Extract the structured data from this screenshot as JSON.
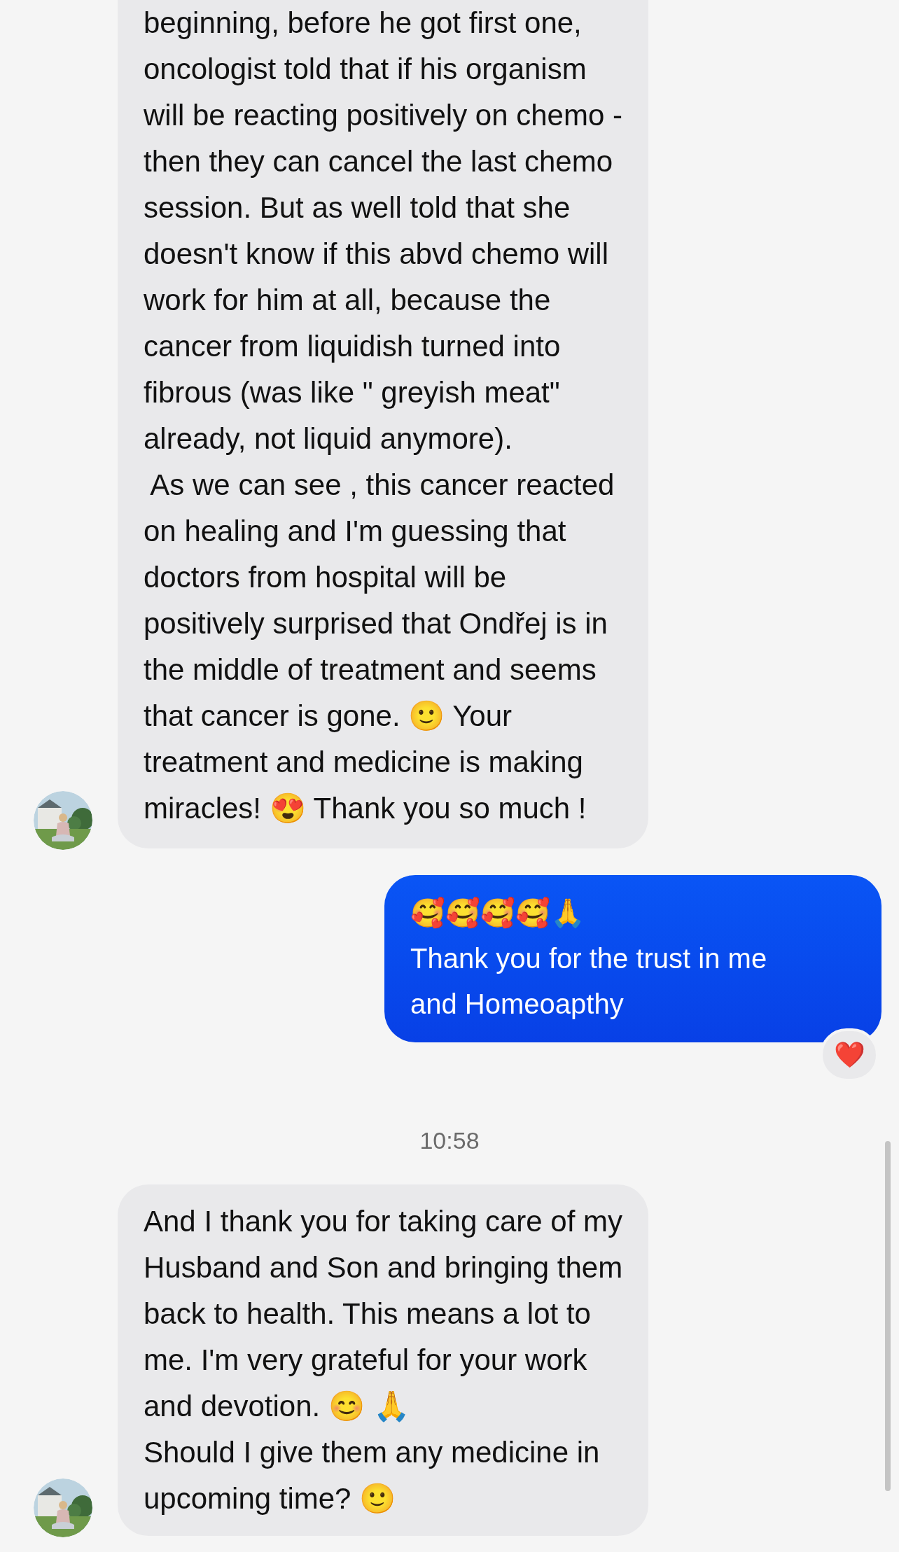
{
  "messages": [
    {
      "kind": "received",
      "text": "beginning, before he got first one,\noncologist told that if his organism\nwill be reacting positively on chemo -\nthen they can cancel the last chemo\nsession. But as well told that she\ndoesn't know if this abvd chemo will\nwork for him at all, because the\ncancer from liquidish turned into\nfibrous (was like \" greyish meat\"\nalready, not liquid anymore).\n As we can see , this cancer reacted\non healing and I'm guessing that\ndoctors from hospital will be\npositively surprised that Ondřej is in\nthe middle of treatment and seems\nthat cancer is gone. 🙂 Your\ntreatment and medicine is making\nmiracles! 😍 Thank you so much !"
    },
    {
      "kind": "sent",
      "text": "🥰🥰🥰🥰🙏\nThank you for the trust in me\nand Homeoapthy",
      "reaction": "❤️"
    },
    {
      "kind": "time",
      "text": "10:58"
    },
    {
      "kind": "received",
      "text": "And I thank you for taking care of my\nHusband and Son and bringing them\nback to health. This means a lot to\nme. I'm very grateful for your work\nand devotion. 😊 🙏\nShould I give them any medicine in\nupcoming time? 🙂"
    }
  ]
}
